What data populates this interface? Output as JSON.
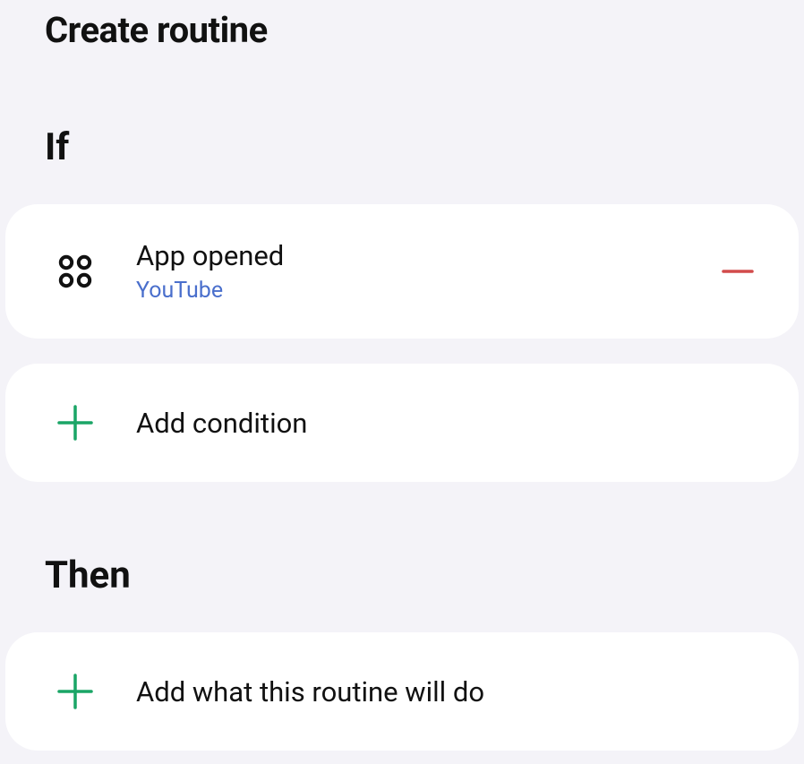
{
  "header": {
    "title": "Create routine"
  },
  "sections": {
    "if": {
      "label": "If",
      "conditions": [
        {
          "title": "App opened",
          "subtitle": "YouTube"
        }
      ],
      "add_label": "Add condition"
    },
    "then": {
      "label": "Then",
      "add_label": "Add what this routine will do"
    }
  },
  "colors": {
    "accent_green": "#1aa566",
    "accent_red": "#d24b4b",
    "link_blue": "#4a6fcc"
  }
}
